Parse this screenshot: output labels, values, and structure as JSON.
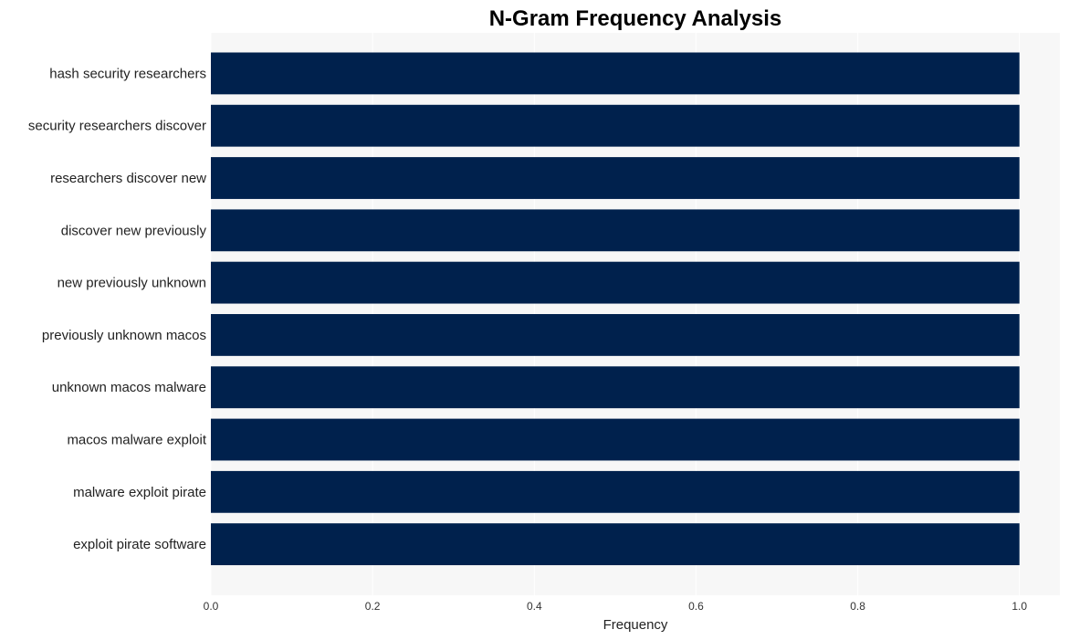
{
  "chart_data": {
    "type": "bar",
    "orientation": "horizontal",
    "title": "N-Gram Frequency Analysis",
    "xlabel": "Frequency",
    "ylabel": "",
    "categories": [
      "hash security researchers",
      "security researchers discover",
      "researchers discover new",
      "discover new previously",
      "new previously unknown",
      "previously unknown macos",
      "unknown macos malware",
      "macos malware exploit",
      "malware exploit pirate",
      "exploit pirate software"
    ],
    "values": [
      1,
      1,
      1,
      1,
      1,
      1,
      1,
      1,
      1,
      1
    ],
    "xlim": [
      0,
      1.05
    ],
    "xticks": [
      0.0,
      0.2,
      0.4,
      0.6,
      0.8,
      1.0
    ],
    "xtick_labels": [
      "0.0",
      "0.2",
      "0.4",
      "0.6",
      "0.8",
      "1.0"
    ],
    "grid": true,
    "legend": "none",
    "colors": {
      "bar": "#00214d",
      "plot_background": "#f7f7f7",
      "grid": "#ffffff"
    }
  }
}
